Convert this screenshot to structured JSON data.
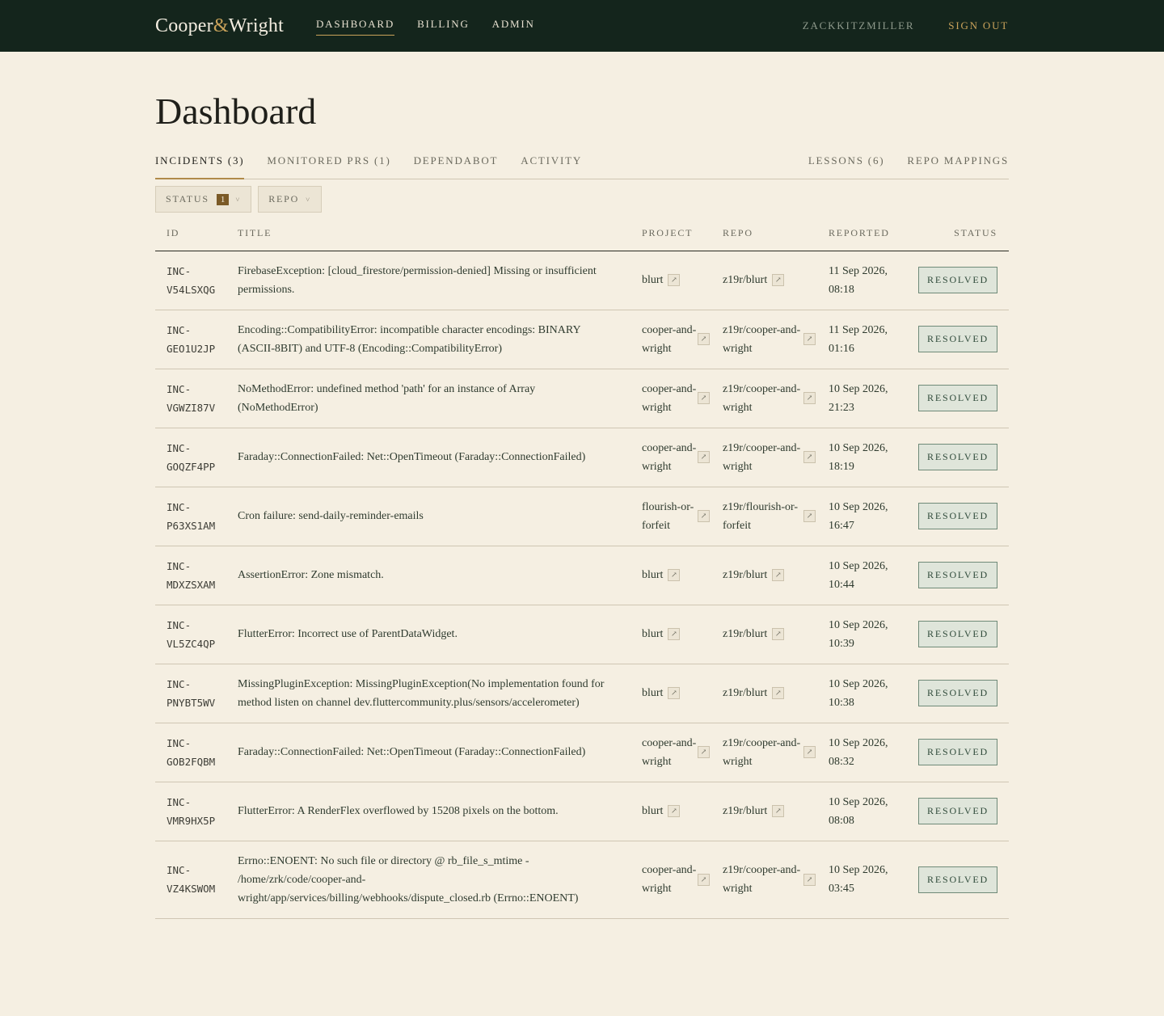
{
  "brand": {
    "part1": "Cooper",
    "amp": "&",
    "part2": "Wright"
  },
  "nav": [
    {
      "label": "DASHBOARD"
    },
    {
      "label": "BILLING"
    },
    {
      "label": "ADMIN"
    }
  ],
  "user": {
    "name": "ZACKKITZMILLER",
    "signout": "SIGN OUT"
  },
  "page_title": "Dashboard",
  "tabs": {
    "incidents": "INCIDENTS (3)",
    "monitored_prs": "MONITORED PRS (1)",
    "dependabot": "DEPENDABOT",
    "activity": "ACTIVITY",
    "lessons": "LESSONS (6)",
    "repo_mappings": "REPO MAPPINGS"
  },
  "filters": {
    "status": {
      "label": "STATUS",
      "count": "1"
    },
    "repo": {
      "label": "REPO"
    }
  },
  "table": {
    "headers": {
      "id": "ID",
      "title": "TITLE",
      "project": "PROJECT",
      "repo": "REPO",
      "reported": "REPORTED",
      "status": "STATUS"
    },
    "rows": [
      {
        "id": "INC-V54LSXQG",
        "title": "FirebaseException: [cloud_firestore/permission-denied] Missing or insufficient permissions.",
        "project": "blurt",
        "repo": "z19r/blurt",
        "reported": "11 Sep 2026, 08:18",
        "status": "RESOLVED"
      },
      {
        "id": "INC-GEO1U2JP",
        "title": "Encoding::CompatibilityError: incompatible character encodings: BINARY (ASCII-8BIT) and UTF-8 (Encoding::CompatibilityError)",
        "project": "cooper-and-wright",
        "repo": "z19r/cooper-and-wright",
        "reported": "11 Sep 2026, 01:16",
        "status": "RESOLVED"
      },
      {
        "id": "INC-VGWZI87V",
        "title": "NoMethodError: undefined method 'path' for an instance of Array (NoMethodError)",
        "project": "cooper-and-wright",
        "repo": "z19r/cooper-and-wright",
        "reported": "10 Sep 2026, 21:23",
        "status": "RESOLVED"
      },
      {
        "id": "INC-GOQZF4PP",
        "title": "Faraday::ConnectionFailed: Net::OpenTimeout (Faraday::ConnectionFailed)",
        "project": "cooper-and-wright",
        "repo": "z19r/cooper-and-wright",
        "reported": "10 Sep 2026, 18:19",
        "status": "RESOLVED"
      },
      {
        "id": "INC-P63XS1AM",
        "title": "Cron failure: send-daily-reminder-emails",
        "project": "flourish-or-forfeit",
        "repo": "z19r/flourish-or-forfeit",
        "reported": "10 Sep 2026, 16:47",
        "status": "RESOLVED"
      },
      {
        "id": "INC-MDXZSXAM",
        "title": "AssertionError: Zone mismatch.",
        "project": "blurt",
        "repo": "z19r/blurt",
        "reported": "10 Sep 2026, 10:44",
        "status": "RESOLVED"
      },
      {
        "id": "INC-VL5ZC4QP",
        "title": "FlutterError: Incorrect use of ParentDataWidget.",
        "project": "blurt",
        "repo": "z19r/blurt",
        "reported": "10 Sep 2026, 10:39",
        "status": "RESOLVED"
      },
      {
        "id": "INC-PNYBT5WV",
        "title": "MissingPluginException: MissingPluginException(No implementation found for method listen on channel dev.fluttercommunity.plus/sensors/accelerometer)",
        "project": "blurt",
        "repo": "z19r/blurt",
        "reported": "10 Sep 2026, 10:38",
        "status": "RESOLVED"
      },
      {
        "id": "INC-GOB2FQBM",
        "title": "Faraday::ConnectionFailed: Net::OpenTimeout (Faraday::ConnectionFailed)",
        "project": "cooper-and-wright",
        "repo": "z19r/cooper-and-wright",
        "reported": "10 Sep 2026, 08:32",
        "status": "RESOLVED"
      },
      {
        "id": "INC-VMR9HX5P",
        "title": "FlutterError: A RenderFlex overflowed by 15208 pixels on the bottom.",
        "project": "blurt",
        "repo": "z19r/blurt",
        "reported": "10 Sep 2026, 08:08",
        "status": "RESOLVED"
      },
      {
        "id": "INC-VZ4KSWOM",
        "title": "Errno::ENOENT: No such file or directory @ rb_file_s_mtime - /home/zrk/code/cooper-and-wright/app/services/billing/webhooks/dispute_closed.rb (Errno::ENOENT)",
        "project": "cooper-and-wright",
        "repo": "z19r/cooper-and-wright",
        "reported": "10 Sep 2026, 03:45",
        "status": "RESOLVED"
      }
    ]
  },
  "icons": {
    "external_link": "external-link-icon",
    "caret": "caret-down-icon"
  },
  "colors": {
    "header_bg": "#14251c",
    "accent": "#c9a25a",
    "page_bg": "#f5efe2",
    "badge_bg": "#dfe5da",
    "badge_border": "#6f8a78"
  }
}
